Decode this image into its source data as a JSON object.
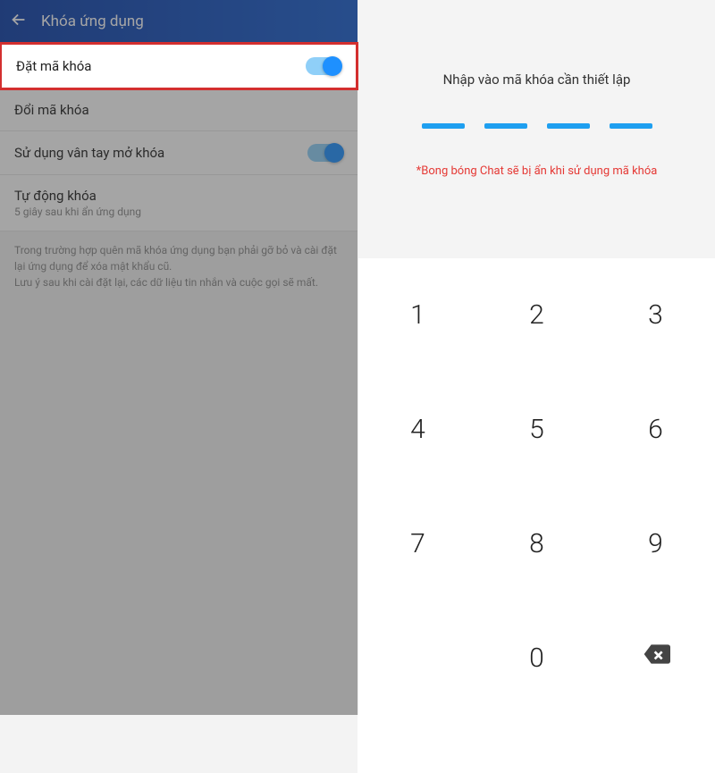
{
  "left": {
    "title": "Khóa ứng dụng",
    "rows": {
      "set_code": {
        "label": "Đặt mã khóa",
        "toggle": true
      },
      "change_code": {
        "label": "Đổi mã khóa"
      },
      "fingerprint": {
        "label": "Sử dụng vân tay mở khóa",
        "toggle": true
      },
      "autolock": {
        "label": "Tự động khóa",
        "sub": "5 giây sau khi ẩn ứng dụng"
      }
    },
    "note1": "Trong trường hợp quên mã khóa ứng dụng bạn phải gỡ bỏ và cài đặt lại ứng dụng để xóa mật khẩu cũ.",
    "note2": "Lưu ý sau khi cài đặt lại, các dữ liệu tin nhắn và cuộc gọi sẽ mất."
  },
  "right": {
    "prompt": "Nhập vào mã khóa cần thiết lập",
    "warn": "*Bong bóng Chat sẽ bị ẩn khi sử dụng mã khóa",
    "keys": [
      "1",
      "2",
      "3",
      "4",
      "5",
      "6",
      "7",
      "8",
      "9",
      "",
      "0"
    ]
  }
}
